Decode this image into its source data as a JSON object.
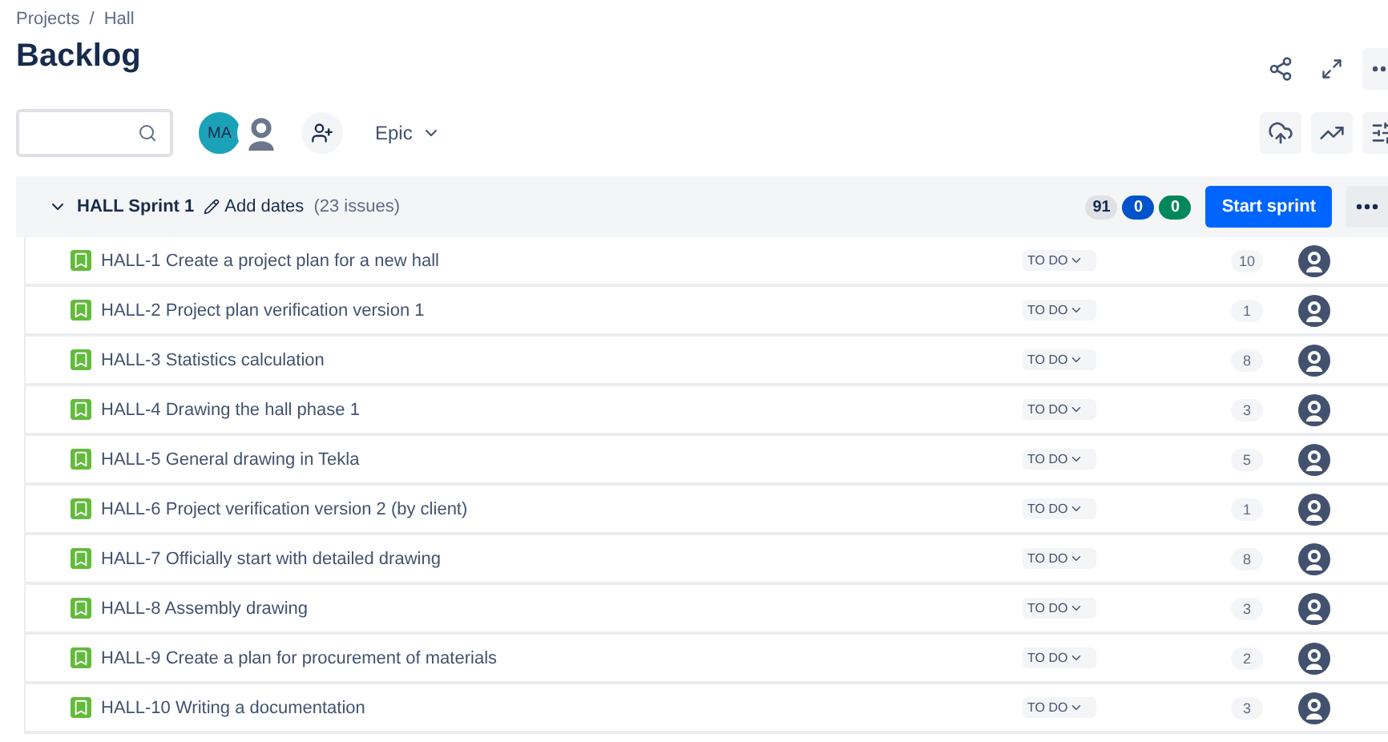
{
  "breadcrumbs": [
    "Projects",
    "Hall"
  ],
  "breadcrumb_separator": "/",
  "title": "Backlog",
  "avatars": [
    {
      "kind": "initials",
      "initials": "MA",
      "color": "#1aa3b8"
    },
    {
      "kind": "silhouette"
    }
  ],
  "filter": {
    "label": "Epic"
  },
  "sprint": {
    "name": "HALL Sprint 1",
    "expanded": true,
    "add_dates": "Add dates",
    "issue_count": "(23 issues)",
    "counts": [
      {
        "kind": "todo",
        "value": "91"
      },
      {
        "kind": "progress",
        "value": "0"
      },
      {
        "kind": "done",
        "value": "0"
      }
    ],
    "start_button": "Start sprint"
  },
  "issues": [
    {
      "key": "HALL-1",
      "summary": "Create a project plan for a new hall",
      "status": "TO DO",
      "points": "10"
    },
    {
      "key": "HALL-2",
      "summary": "Project plan verification version 1",
      "status": "TO DO",
      "points": "1"
    },
    {
      "key": "HALL-3",
      "summary": "Statistics calculation",
      "status": "TO DO",
      "points": "8"
    },
    {
      "key": "HALL-4",
      "summary": "Drawing the hall phase 1",
      "status": "TO DO",
      "points": "3"
    },
    {
      "key": "HALL-5",
      "summary": "General drawing in Tekla",
      "status": "TO DO",
      "points": "5"
    },
    {
      "key": "HALL-6",
      "summary": "Project verification version 2 (by client)",
      "status": "TO DO",
      "points": "1"
    },
    {
      "key": "HALL-7",
      "summary": "Officially start with detailed drawing",
      "status": "TO DO",
      "points": "8"
    },
    {
      "key": "HALL-8",
      "summary": "Assembly drawing",
      "status": "TO DO",
      "points": "3"
    },
    {
      "key": "HALL-9",
      "summary": "Create a plan for procurement of materials",
      "status": "TO DO",
      "points": "2"
    },
    {
      "key": "HALL-10",
      "summary": "Writing a documentation",
      "status": "TO DO",
      "points": "3"
    }
  ]
}
